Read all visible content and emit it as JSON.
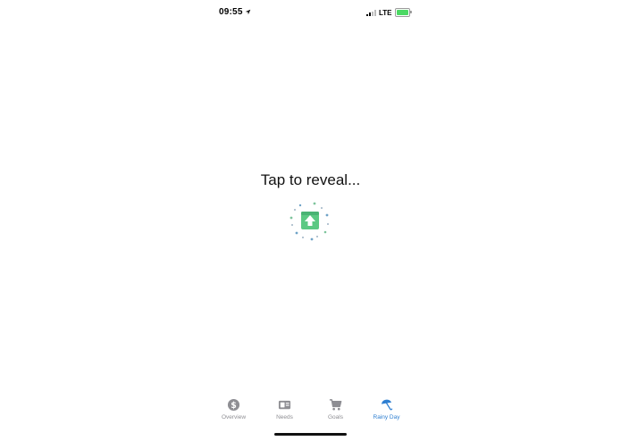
{
  "status_bar": {
    "time": "09:55",
    "network": "LTE",
    "battery_color": "#4cd964"
  },
  "main": {
    "reveal_text": "Tap to reveal...",
    "reveal_icon": "gift-box-icon",
    "accent_color": "#5cc983"
  },
  "tab_bar": {
    "active_color": "#2f7fd1",
    "inactive_color": "#8e8e93",
    "tabs": [
      {
        "label": "Overview",
        "icon": "dollar-coin-icon",
        "active": false
      },
      {
        "label": "Needs",
        "icon": "wallet-icon",
        "active": false
      },
      {
        "label": "Goals",
        "icon": "cart-icon",
        "active": false
      },
      {
        "label": "Rainy Day",
        "icon": "umbrella-icon",
        "active": true
      }
    ]
  }
}
